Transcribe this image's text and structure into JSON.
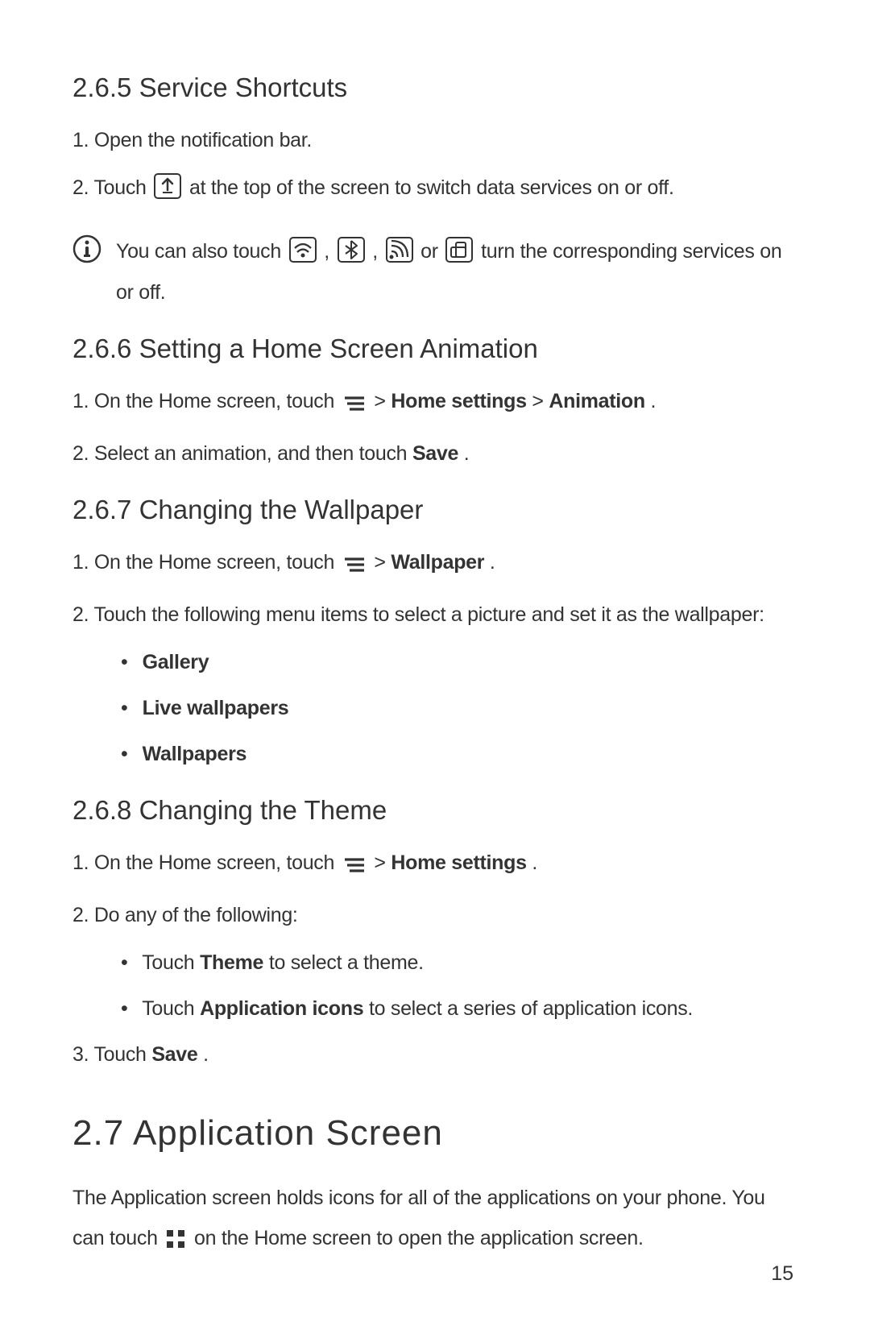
{
  "page_number": "15",
  "sections": {
    "s1": {
      "heading": "2.6.5  Service Shortcuts",
      "items": {
        "i1": "1. Open the notification bar.",
        "i2a": "2. Touch ",
        "i2b": " at the top of the screen to switch data services on or off."
      },
      "note": {
        "a": "You can also touch ",
        "b": " , ",
        "c": " , ",
        "d": " or ",
        "e": " turn the corresponding services on or off."
      }
    },
    "s2": {
      "heading": "2.6.6  Setting a Home Screen Animation",
      "i1a": "1. On the Home screen, touch ",
      "i1b": " > ",
      "i1c": "Home settings",
      "i1d": " > ",
      "i1e": "Animation",
      "i1f": ".",
      "i2a": "2. Select an animation, and then touch ",
      "i2b": "Save",
      "i2c": "."
    },
    "s3": {
      "heading": "2.6.7  Changing the Wallpaper",
      "i1a": "1. On the Home screen, touch ",
      "i1b": " > ",
      "i1c": "Wallpaper",
      "i1d": ".",
      "i2": "2. Touch the following menu items to select a picture and set it as the wallpaper:",
      "sub": {
        "a": "Gallery",
        "b": "Live wallpapers",
        "c": "Wallpapers"
      }
    },
    "s4": {
      "heading": "2.6.8  Changing the Theme",
      "i1a": "1. On the Home screen, touch ",
      "i1b": " > ",
      "i1c": "Home settings",
      "i1d": ".",
      "i2": "2. Do any of the following:",
      "i2sub": {
        "a1": "Touch ",
        "a2": "Theme",
        "a3": " to select a theme.",
        "b1": "Touch ",
        "b2": "Application icons",
        "b3": " to select a series of application icons."
      },
      "i3a": "3. Touch ",
      "i3b": "Save",
      "i3c": "."
    },
    "s5": {
      "heading": "2.7  Application Screen",
      "p1a": "The Application screen holds icons for all of the applications on your phone. You can touch ",
      "p1b": " on the Home screen to open the application screen."
    }
  }
}
